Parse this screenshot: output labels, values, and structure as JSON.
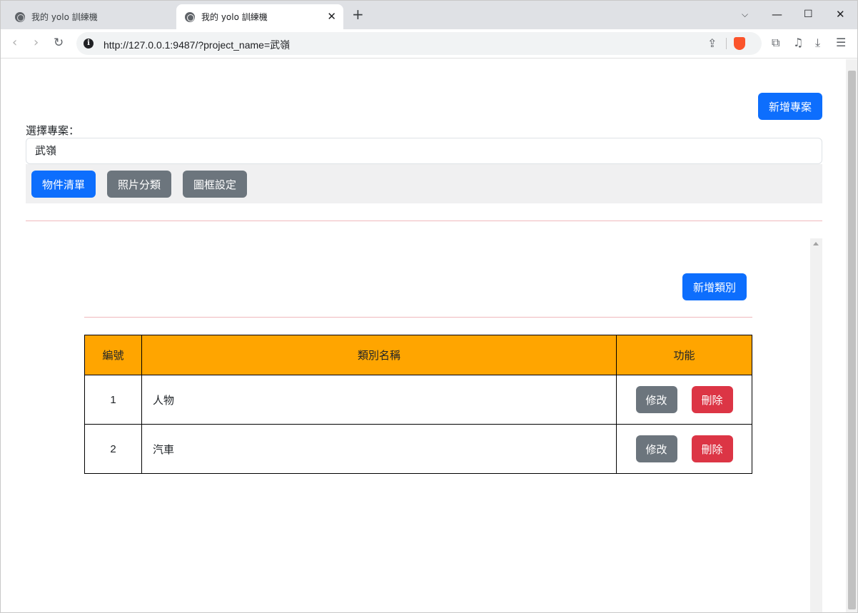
{
  "browser": {
    "tabs": [
      {
        "title": "我的 yolo 訓練機",
        "active": false
      },
      {
        "title": "我的 yolo 訓練機",
        "active": true
      }
    ],
    "url": "http://127.0.0.1:9487/?project_name=武嶺"
  },
  "page": {
    "add_project_label": "新增專案",
    "select_project_label": "選擇專案：",
    "selected_project": "武嶺",
    "nav_buttons": [
      {
        "label": "物件清單",
        "variant": "primary"
      },
      {
        "label": "照片分類",
        "variant": "secondary"
      },
      {
        "label": "圖框設定",
        "variant": "secondary"
      }
    ]
  },
  "object_list": {
    "add_category_label": "新增類別",
    "table": {
      "headers": [
        "編號",
        "類別名稱",
        "功能"
      ],
      "rows": [
        {
          "id": "1",
          "name": "人物",
          "edit_label": "修改",
          "delete_label": "刪除"
        },
        {
          "id": "2",
          "name": "汽車",
          "edit_label": "修改",
          "delete_label": "刪除"
        }
      ]
    }
  },
  "colors": {
    "primary": "#0d6efd",
    "secondary": "#6c757d",
    "danger": "#dc3545",
    "table_header": "#ffa500"
  }
}
